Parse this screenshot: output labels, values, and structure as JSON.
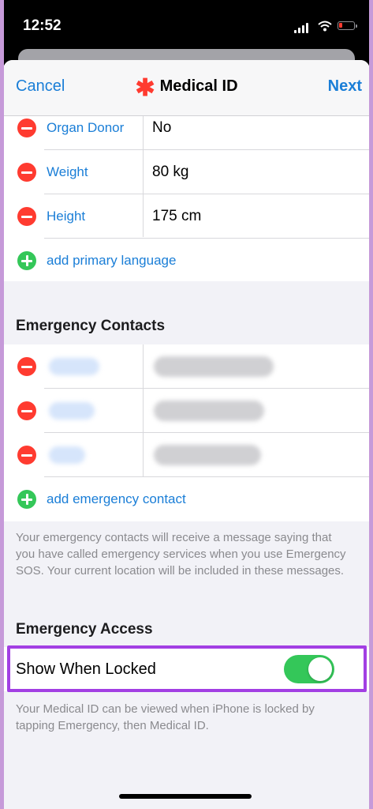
{
  "status_bar": {
    "time": "12:52"
  },
  "nav": {
    "cancel": "Cancel",
    "title": "Medical ID",
    "next": "Next"
  },
  "personal": {
    "rows": [
      {
        "label": "Organ Donor",
        "value": "No"
      },
      {
        "label": "Weight",
        "value": "80 kg"
      },
      {
        "label": "Height",
        "value": "175 cm"
      }
    ],
    "add_language": "add primary language"
  },
  "emergency_contacts": {
    "header": "Emergency Contacts",
    "add_contact": "add emergency contact",
    "footnote": "Your emergency contacts will receive a message saying that you have called emergency services when you use Emergency SOS. Your current location will be included in these messages."
  },
  "emergency_access": {
    "header": "Emergency Access",
    "toggle_label": "Show When Locked",
    "toggle_on": true,
    "footnote": "Your Medical ID can be viewed when iPhone is locked by tapping Emergency, then Medical ID."
  },
  "colors": {
    "accent": "#1a7ed7",
    "destructive": "#ff3b30",
    "success": "#34c759",
    "highlight": "#a23fe3"
  }
}
